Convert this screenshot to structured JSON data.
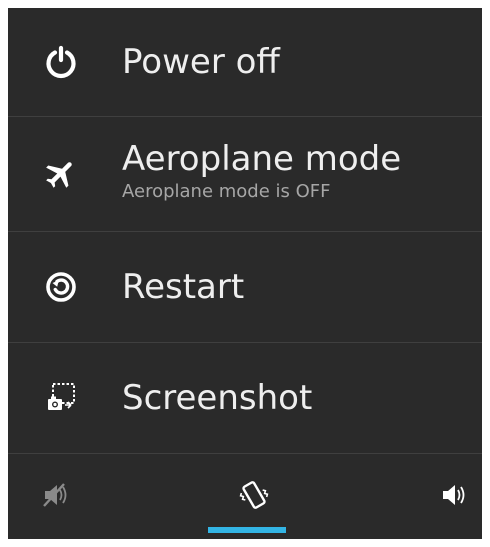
{
  "menu": {
    "items": [
      {
        "id": "power-off",
        "label": "Power off",
        "icon": "power-icon"
      },
      {
        "id": "aeroplane-mode",
        "label": "Aeroplane mode",
        "sublabel": "Aeroplane mode is OFF",
        "icon": "airplane-icon"
      },
      {
        "id": "restart",
        "label": "Restart",
        "icon": "restart-icon"
      },
      {
        "id": "screenshot",
        "label": "Screenshot",
        "icon": "screenshot-icon"
      }
    ]
  },
  "sound_modes": {
    "options": [
      {
        "id": "silent",
        "icon": "sound-off-icon",
        "selected": false
      },
      {
        "id": "vibrate",
        "icon": "vibrate-icon",
        "selected": true
      },
      {
        "id": "sound-on",
        "icon": "sound-on-icon",
        "selected": false
      }
    ]
  },
  "colors": {
    "background": "#2a2a2a",
    "text_primary": "#eeeeee",
    "text_secondary": "#a6a6a6",
    "divider": "#3f3f3f",
    "accent": "#33b5e5"
  }
}
